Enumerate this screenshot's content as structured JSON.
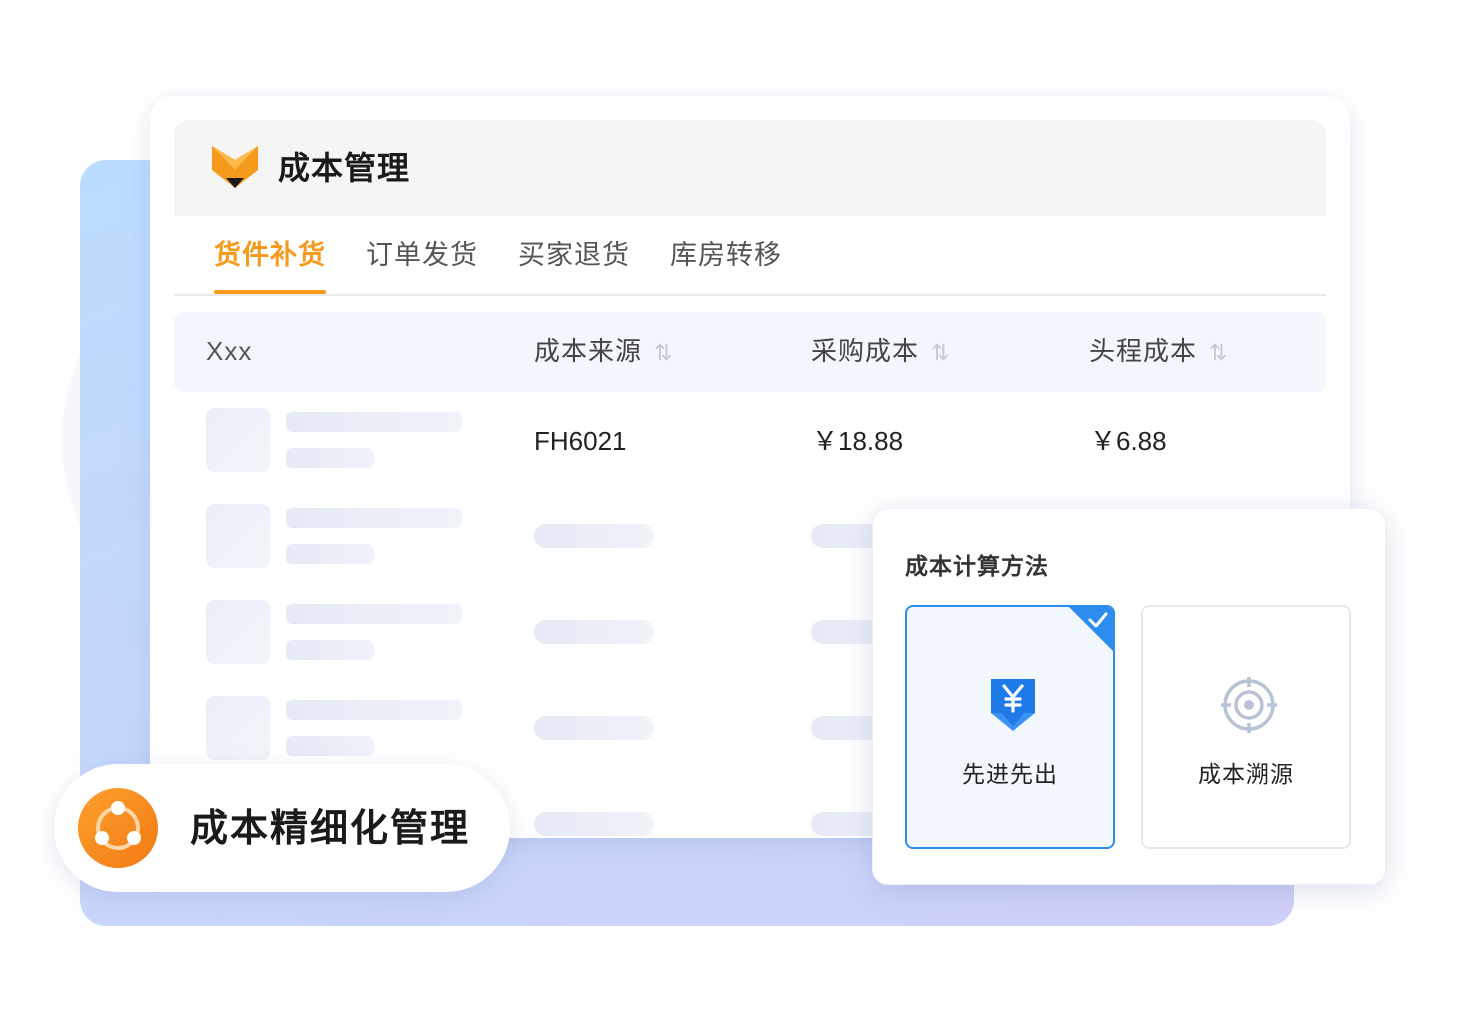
{
  "header": {
    "title": "成本管理"
  },
  "tabs": [
    {
      "label": "货件补货",
      "active": true
    },
    {
      "label": "订单发货",
      "active": false
    },
    {
      "label": "买家退货",
      "active": false
    },
    {
      "label": "库房转移",
      "active": false
    }
  ],
  "table": {
    "columns": [
      "Xxx",
      "成本来源",
      "采购成本",
      "头程成本"
    ],
    "sort_icon": "⇅",
    "rows": [
      {
        "source": "FH6021",
        "purchase_cost": "￥18.88",
        "first_leg_cost": "￥6.88"
      }
    ]
  },
  "popup": {
    "title": "成本计算方法",
    "options": [
      {
        "label": "先进先出",
        "selected": true,
        "icon": "yuan-down-icon"
      },
      {
        "label": "成本溯源",
        "selected": false,
        "icon": "target-icon"
      }
    ]
  },
  "badge": {
    "text": "成本精细化管理",
    "icon": "network-nodes-icon"
  },
  "colors": {
    "accent_orange": "#f59a1b",
    "accent_blue": "#2d8cf0",
    "panel_gradient_start": "#bcdcff",
    "panel_gradient_end": "#cfd0fa"
  }
}
